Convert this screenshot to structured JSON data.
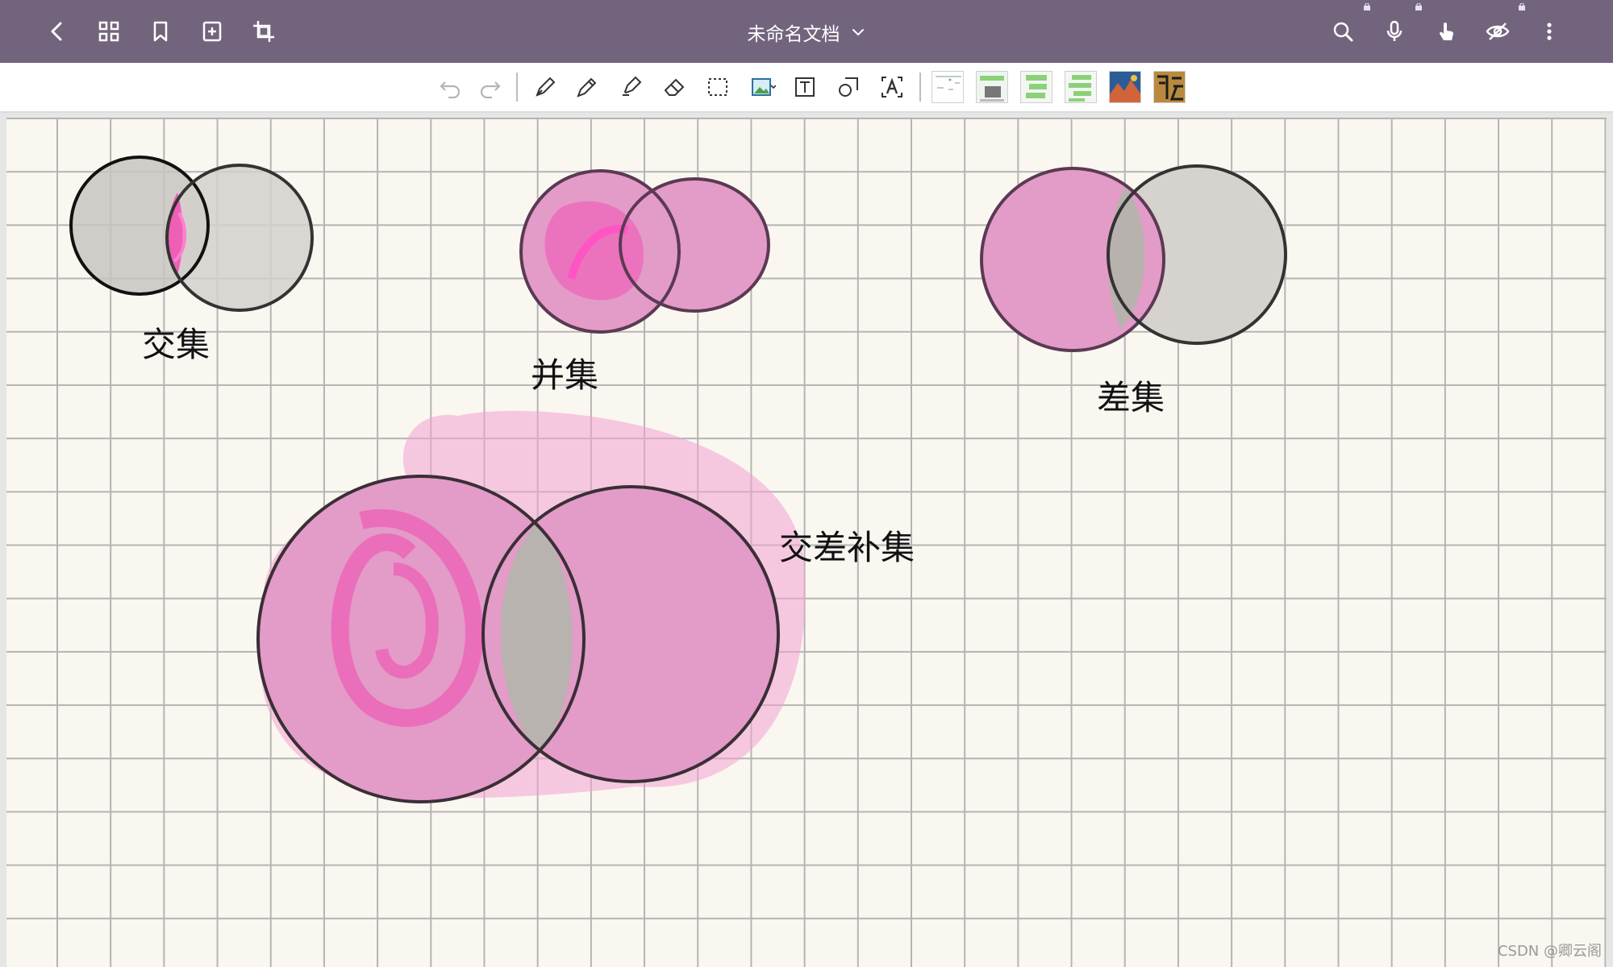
{
  "app": {
    "title": "未命名文档",
    "colors": {
      "topbar": "#73647e",
      "pink": "#e27ab8",
      "hot_pink": "#f05bb3",
      "gray_fill": "#b7b5b2"
    }
  },
  "topbar": {
    "left_icons": [
      "back-icon",
      "grid-icon",
      "bookmark-icon",
      "add-page-icon",
      "crop-icon"
    ],
    "right_icons": [
      "search-icon",
      "microphone-icon",
      "touch-icon",
      "hide-icon",
      "more-icon"
    ]
  },
  "toolbar": {
    "tools": [
      "undo-icon",
      "redo-icon",
      "fountain-pen-icon",
      "pen-icon",
      "highlighter-icon",
      "eraser-icon",
      "lasso-select-icon",
      "image-insert-icon",
      "text-box-icon",
      "shape-icon",
      "text-recognition-icon"
    ],
    "recent_thumbnails": 6
  },
  "canvas": {
    "labels": {
      "intersection": "交集",
      "union": "并集",
      "difference": "差集",
      "symmetric_difference": "交差补集"
    }
  },
  "watermark": "CSDN @卿云阁"
}
